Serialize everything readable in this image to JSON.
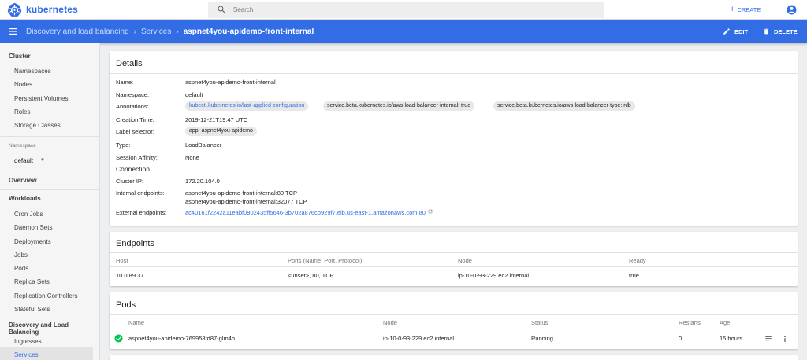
{
  "app": {
    "name": "kubernetes"
  },
  "search": {
    "placeholder": "Search"
  },
  "topbar": {
    "create_label": "CREATE"
  },
  "breadcrumb": {
    "items": [
      "Discovery and load balancing",
      "Services"
    ],
    "current": "aspnet4you-apidemo-front-internal"
  },
  "actions": {
    "edit_label": "EDIT",
    "delete_label": "DELETE"
  },
  "sidebar": {
    "cluster_header": "Cluster",
    "cluster_items": [
      "Namespaces",
      "Nodes",
      "Persistent Volumes",
      "Roles",
      "Storage Classes"
    ],
    "namespace_label": "Namespace",
    "namespace_value": "default",
    "overview": "Overview",
    "workloads_header": "Workloads",
    "workload_items": [
      "Cron Jobs",
      "Daemon Sets",
      "Deployments",
      "Jobs",
      "Pods",
      "Replica Sets",
      "Replication Controllers",
      "Stateful Sets"
    ],
    "discovery_header": "Discovery and Load Balancing",
    "discovery_items": [
      "Ingresses",
      "Services"
    ]
  },
  "details": {
    "title": "Details",
    "name_label": "Name:",
    "name": "aspnet4you-apidemo-front-internal",
    "namespace_label": "Namespace:",
    "namespace": "default",
    "annotations_label": "Annotations:",
    "annotations": [
      "kubectl.kubernetes.io/last-applied-configuration",
      "service.beta.kubernetes.io/aws-load-balancer-internal:  true",
      "service.beta.kubernetes.io/aws-load-balancer-type:  nlb"
    ],
    "creation_label": "Creation Time:",
    "creation": "2019-12-21T19:47 UTC",
    "selector_label": "Label selector:",
    "selector": "app:  aspnet4you-apidemo",
    "type_label": "Type:",
    "type": "LoadBalancer",
    "affinity_label": "Session Affinity:",
    "affinity": "None",
    "connection_header": "Connection",
    "cluster_ip_label": "Cluster IP:",
    "cluster_ip": "172.20.104.0",
    "internal_label": "Internal endpoints:",
    "internal_1": "aspnet4you-apidemo-front-internal:80 TCP",
    "internal_2": "aspnet4you-apidemo-front-internal:32077 TCP",
    "external_label": "External endpoints:",
    "external": "ac40161f2242a11eabf0902435ff5646-3b702a876cb929f7.elb.us-east-1.amazonaws.com:80"
  },
  "endpoints": {
    "title": "Endpoints",
    "headers": [
      "Host",
      "Ports (Name, Port, Protocol)",
      "Node",
      "Ready"
    ],
    "rows": [
      {
        "host": "10.0.89.37",
        "ports": "<unset>, 80, TCP",
        "node": "ip-10-0-93-229.ec2.internal",
        "ready": "true"
      }
    ]
  },
  "pods": {
    "title": "Pods",
    "headers": [
      "Name",
      "Node",
      "Status",
      "Restarts",
      "Age"
    ],
    "rows": [
      {
        "name": "aspnet4you-apidemo-769958fd87-glm4h",
        "node": "ip-10-0-93-229.ec2.internal",
        "status": "Running",
        "restarts": "0",
        "age": "15 hours"
      }
    ]
  },
  "colors": {
    "accent": "#326de6",
    "success": "#00c752"
  }
}
